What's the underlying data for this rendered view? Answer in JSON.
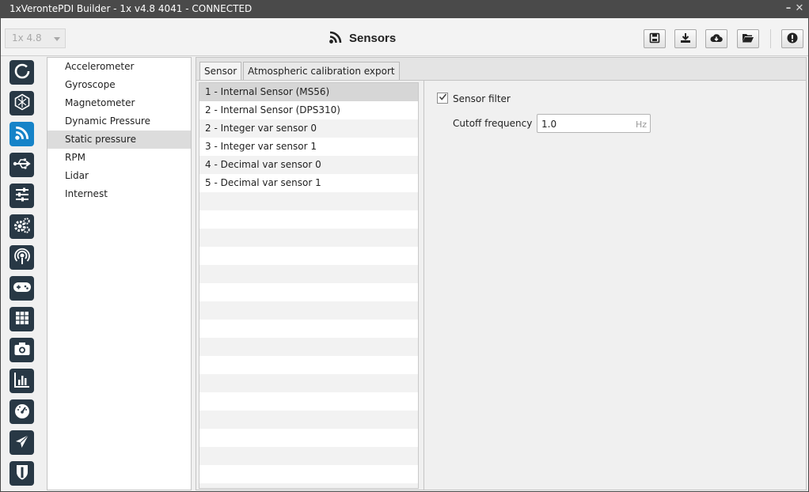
{
  "window": {
    "title": "1xVerontePDI Builder - 1x v4.8 4041 - CONNECTED"
  },
  "titlebar": {
    "minimize_icon": "minimize-icon",
    "close_icon": "close-icon"
  },
  "toolbar": {
    "version_select": "1x 4.8",
    "page_title": "Sensors",
    "page_icon": "rss-icon",
    "buttons": [
      "save-icon",
      "download-icon",
      "cloud-download-icon",
      "folder-open-icon",
      "alert-icon"
    ]
  },
  "sidebar_icons": [
    {
      "name": "circle-notch-icon",
      "active": false
    },
    {
      "name": "sensor-hex-icon",
      "active": false
    },
    {
      "name": "rss-icon",
      "active": true
    },
    {
      "name": "usb-icon",
      "active": false
    },
    {
      "name": "sliders-icon",
      "active": false
    },
    {
      "name": "cogs-icon",
      "active": false
    },
    {
      "name": "broadcast-icon",
      "active": false
    },
    {
      "name": "gamepad-icon",
      "active": false
    },
    {
      "name": "grid-icon",
      "active": false
    },
    {
      "name": "camera-icon",
      "active": false
    },
    {
      "name": "bar-chart-icon",
      "active": false
    },
    {
      "name": "gauge-icon",
      "active": false
    },
    {
      "name": "airplane-icon",
      "active": false
    },
    {
      "name": "shield-icon",
      "active": false
    }
  ],
  "categories": {
    "items": [
      "Accelerometer",
      "Gyroscope",
      "Magnetometer",
      "Dynamic Pressure",
      "Static pressure",
      "RPM",
      "Lidar",
      "Internest"
    ],
    "selected": "Static pressure"
  },
  "tabs": {
    "items": [
      "Sensor",
      "Atmospheric calibration export"
    ],
    "active": "Sensor"
  },
  "sensors": {
    "items": [
      "1 - Internal Sensor (MS56)",
      "2 - Internal Sensor (DPS310)",
      "2 - Integer var sensor 0",
      "3 - Integer var sensor 1",
      "4 - Decimal var sensor 0",
      "5 - Decimal var sensor 1"
    ],
    "selected": "1 - Internal Sensor (MS56)"
  },
  "settings": {
    "sensor_filter_label": "Sensor filter",
    "sensor_filter_checked": true,
    "cutoff_label": "Cutoff frequency",
    "cutoff_value": "1.0",
    "cutoff_unit": "Hz"
  },
  "colors": {
    "titlebar": "#4a4a4a",
    "nav_button": "#283845",
    "nav_active": "#1683c8",
    "selection": "#dcdcdc"
  }
}
